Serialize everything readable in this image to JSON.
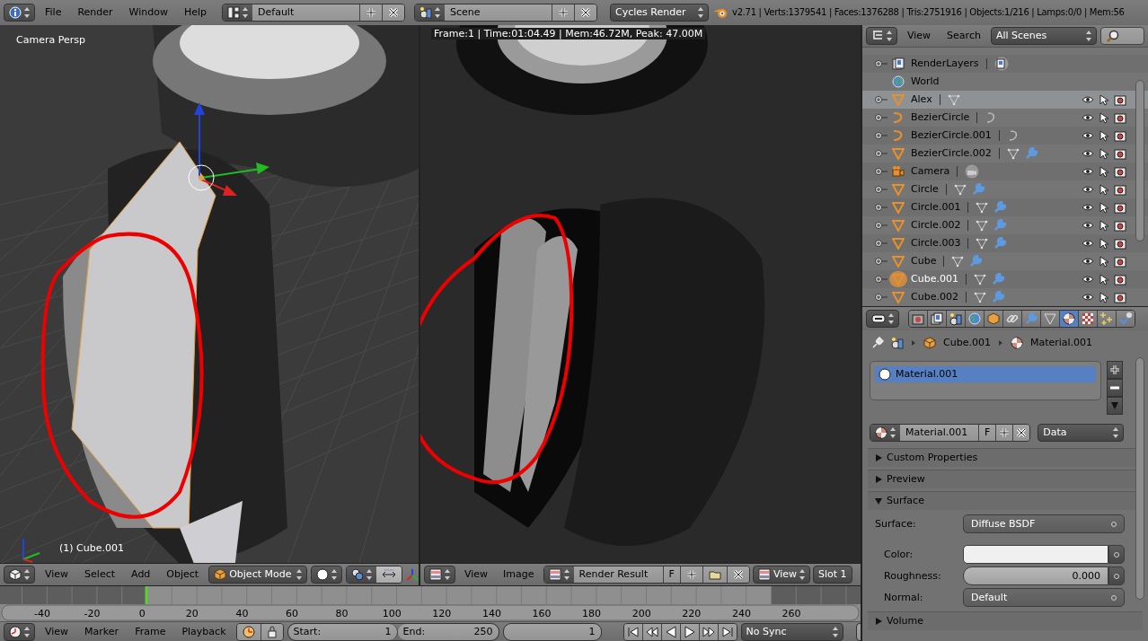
{
  "info_header": {
    "menu": [
      "File",
      "Render",
      "Window",
      "Help"
    ],
    "screen_layout": "Default",
    "scene": "Scene",
    "render_engine": "Cycles Render",
    "stats": "v2.71 | Verts:1379541 | Faces:1376288 | Tris:2751916 | Objects:1/216 | Lamps:0/0 | Mem:56"
  },
  "viewport": {
    "view_name": "Camera Persp",
    "object_label": "(1) Cube.001",
    "menu": [
      "View",
      "Select",
      "Add",
      "Object"
    ],
    "mode": "Object Mode",
    "manipulator": true
  },
  "image_editor": {
    "render_info": "Frame:1 | Time:01:04.49 | Mem:46.72M, Peak: 47.00M",
    "menu": [
      "View",
      "Image"
    ],
    "image": "Render Result",
    "fake_user": "F",
    "view": "View",
    "slot": "Slot 1"
  },
  "outliner": {
    "menu": [
      "View",
      "Search"
    ],
    "display": "All Scenes",
    "items": [
      {
        "name": "RenderLayers",
        "kind": "renderlayers",
        "expandable": true,
        "modifier": false,
        "selected": false,
        "active": false,
        "restrictions": false
      },
      {
        "name": "World",
        "kind": "world",
        "expandable": false,
        "modifier": false,
        "selected": false,
        "active": false,
        "restrictions": false
      },
      {
        "name": "Alex",
        "kind": "mesh",
        "expandable": true,
        "modifier": false,
        "selected": true,
        "active": false,
        "restrictions": true
      },
      {
        "name": "BezierCircle",
        "kind": "curve",
        "expandable": true,
        "modifier": false,
        "selected": false,
        "active": false,
        "restrictions": true
      },
      {
        "name": "BezierCircle.001",
        "kind": "curve",
        "expandable": true,
        "modifier": false,
        "selected": false,
        "active": false,
        "restrictions": true
      },
      {
        "name": "BezierCircle.002",
        "kind": "mesh",
        "expandable": true,
        "modifier": true,
        "selected": false,
        "active": false,
        "restrictions": true
      },
      {
        "name": "Camera",
        "kind": "camera",
        "expandable": true,
        "modifier": false,
        "selected": false,
        "active": false,
        "restrictions": true
      },
      {
        "name": "Circle",
        "kind": "mesh",
        "expandable": true,
        "modifier": true,
        "selected": false,
        "active": false,
        "restrictions": true
      },
      {
        "name": "Circle.001",
        "kind": "mesh",
        "expandable": true,
        "modifier": true,
        "selected": false,
        "active": false,
        "restrictions": true
      },
      {
        "name": "Circle.002",
        "kind": "mesh",
        "expandable": true,
        "modifier": true,
        "selected": false,
        "active": false,
        "restrictions": true
      },
      {
        "name": "Circle.003",
        "kind": "mesh",
        "expandable": true,
        "modifier": true,
        "selected": false,
        "active": false,
        "restrictions": true
      },
      {
        "name": "Cube",
        "kind": "mesh",
        "expandable": true,
        "modifier": true,
        "selected": false,
        "active": false,
        "restrictions": true
      },
      {
        "name": "Cube.001",
        "kind": "mesh",
        "expandable": true,
        "modifier": true,
        "selected": false,
        "active": true,
        "restrictions": true
      },
      {
        "name": "Cube.002",
        "kind": "mesh",
        "expandable": true,
        "modifier": true,
        "selected": false,
        "active": false,
        "restrictions": true
      }
    ]
  },
  "properties": {
    "tabs": [
      {
        "kind": "render",
        "selected": false
      },
      {
        "kind": "layers",
        "selected": false
      },
      {
        "kind": "scene",
        "selected": false
      },
      {
        "kind": "world",
        "selected": false
      },
      {
        "kind": "object",
        "selected": false
      },
      {
        "kind": "constraints",
        "selected": false
      },
      {
        "kind": "modifiers",
        "selected": false
      },
      {
        "kind": "data",
        "selected": false
      },
      {
        "kind": "material",
        "selected": true
      },
      {
        "kind": "texture",
        "selected": false
      },
      {
        "kind": "particles",
        "selected": false
      },
      {
        "kind": "physics",
        "selected": false
      }
    ],
    "breadcrumb": [
      "Cube.001",
      "Material.001"
    ],
    "material_slots": [
      {
        "name": "Material.001",
        "selected": true
      }
    ],
    "material": "Material.001",
    "fake_user": "F",
    "link": "Data",
    "panels": [
      {
        "title": "Custom Properties",
        "expanded": false
      },
      {
        "title": "Preview",
        "expanded": false
      },
      {
        "title": "Surface",
        "expanded": true
      },
      {
        "title": "Volume",
        "expanded": false
      }
    ],
    "surface_fields": [
      {
        "kind": "menu",
        "label": "Surface:",
        "value": "Diffuse BSDF"
      },
      {
        "kind": "color",
        "label": "Color:"
      },
      {
        "kind": "slider",
        "label": "Roughness:",
        "value": "0.000",
        "level": 0
      },
      {
        "kind": "menu",
        "label": "Normal:",
        "value": "Default"
      }
    ]
  },
  "timeline": {
    "ticks": [
      "-40",
      "-20",
      "0",
      "20",
      "40",
      "60",
      "80",
      "100",
      "120",
      "140",
      "160",
      "180",
      "200",
      "220",
      "240",
      "260"
    ],
    "menu": [
      "View",
      "Marker",
      "Frame",
      "Playback"
    ],
    "start_label": "Start:",
    "start": "1",
    "end_label": "End:",
    "end": "250",
    "current": "1",
    "sync": "No Sync"
  }
}
